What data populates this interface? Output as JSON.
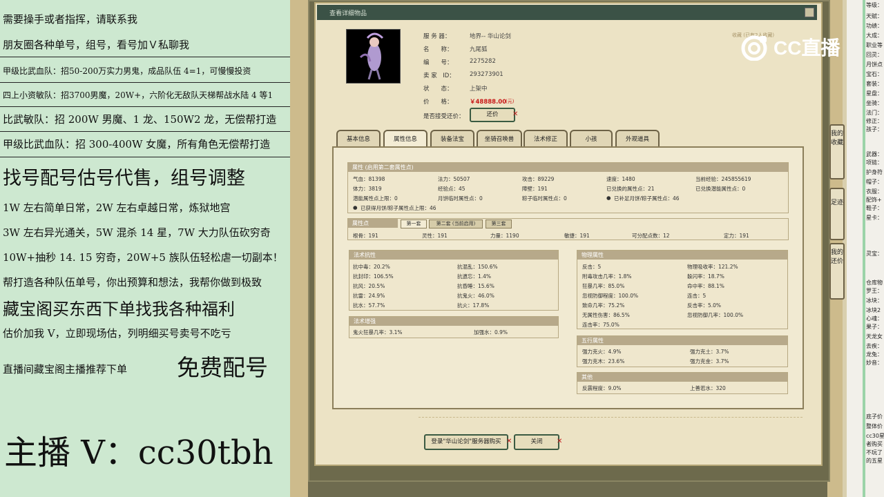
{
  "promo": {
    "lines": [
      "需要操手或者指挥，请联系我",
      "朋友圈各种单号，组号，看号加Ｖ私聊我",
      "甲级比武血队：招50-200万实力男鬼，成品队伍 4=1，可慢慢投资",
      "四上小资敏队：招3700男魔，20W+，六阶化无敌队天梯帮战水陆 4 等1",
      "比武敏队：招 200W 男魔、1 龙、150W2 龙，无偿帮打造",
      "甲级比武血队：招 300-400W 女魔，所有角色无偿帮打造",
      "找号配号估号代售，组号调整",
      "1W 左右简单日常，2W 左右卓越日常，炼狱地宫",
      "3W 左右异光通关，5W 混杀 14 星，7W 大力队伍砍穷奇",
      "10W+抽秒 14. 15 穷奇，20W+5 族队伍轻松虐一切副本！",
      "帮打造各种队伍单号，你出预算和想法，我帮你做到极致",
      "藏宝阁买东西下单找我各种福利",
      "估价加我 V，立即现场估，列明细买号卖号不吃亏",
      "直播间藏宝阁主播推荐下单",
      "免费配号",
      "主播 V：cc30tbh"
    ]
  },
  "window": {
    "title": "查看详细物品"
  },
  "brand": {
    "logo_text": "CC直播",
    "watermark": "收藏 (已有2人收藏)"
  },
  "item": {
    "labels": [
      "服 务 器：",
      "名　　称：",
      "编　　号：",
      "卖 家　ID：",
      "状　　态：",
      "价　　格：",
      "是否接受还价："
    ],
    "server": "地界-- 华山论剑",
    "name": "九尾狐",
    "number": "2275282",
    "seller_id": "293273901",
    "status": "上架中",
    "price": "￥48888.00",
    "price_unit": "(元)",
    "counter_btn": "还价"
  },
  "tabs": [
    "基本信息",
    "属性信息",
    "装备法宝",
    "坐骑召唤兽",
    "法术修正",
    "小孩",
    "外观道具"
  ],
  "attr": {
    "head": "属性 (启用第二套属性点)",
    "rows": [
      [
        "气血：81398",
        "法力：50507",
        "攻击：89229",
        "速度：1480",
        "当前经验：245855619"
      ],
      [
        "体力：3819",
        "经验点：45",
        "障壁：191",
        "已兑换的属性点：21",
        "已兑换潜能属性点：0"
      ],
      [
        "潜能属性点上限：0",
        "月饼临时属性点：0",
        "粽子临时属性点：0",
        "已补足月饼/粽子属性点：46",
        ""
      ]
    ],
    "note": "已获得月饼/粽子属性点上限：46"
  },
  "points": {
    "head": "属性点",
    "subtabs": [
      "第一套",
      "第二套 (当前启用)",
      "第三套"
    ],
    "row": [
      "根骨：191",
      "灵性：191",
      "力量：1190",
      "敏捷：191",
      "可分配点数：12",
      "定力：191"
    ]
  },
  "resist": {
    "head": "法术抗性",
    "rows": [
      [
        "抗中毒：20.2%",
        "抗混乱：150.6%"
      ],
      [
        "抗封印：106.5%",
        "抗遗忘：1.4%"
      ],
      [
        "抗风：20.5%",
        "抗昏睡：15.6%"
      ],
      [
        "抗雷：24.9%",
        "抗鬼火：46.0%"
      ],
      [
        "抗水：57.7%",
        "抗火：17.8%"
      ]
    ]
  },
  "enhance": {
    "head": "法术增强",
    "row": [
      "鬼火狂暴几率：3.1%",
      "加强水：0.9%"
    ]
  },
  "physical": {
    "head": "物理属性",
    "rows": [
      [
        "反击：5",
        "物理吸收率：121.2%"
      ],
      [
        "附毒攻击几率：1.8%",
        "躲闪率：18.7%"
      ],
      [
        "狂暴几率：85.0%",
        "命中率：88.1%"
      ],
      [
        "忽视防御程度：100.0%",
        "连击：5"
      ],
      [
        "致命几率：75.2%",
        "反击率：5.0%"
      ],
      [
        "无属性伤害：86.5%",
        "忽视防御几率：100.0%"
      ],
      [
        "连击率：75.0%",
        ""
      ]
    ]
  },
  "five": {
    "head": "五行属性",
    "rows": [
      [
        "强力克火：4.9%",
        "强力克土：3.7%"
      ],
      [
        "强力克木：23.6%",
        "强力克金：3.7%"
      ]
    ]
  },
  "other": {
    "head": "其他",
    "row": [
      "反震程度：9.0%",
      "上善若水：320"
    ]
  },
  "footer": {
    "buy_btn": "登录\"华山论剑\"服务器购买",
    "close_btn": "关闭"
  },
  "side_buttons": [
    "我的收藏",
    "足迹",
    "我的还价"
  ],
  "chat": [
    "等级：",
    "天赋：",
    "功绩：",
    "大成：",
    "职业等",
    "回灵：",
    "月饼点",
    "宝石：",
    "套装：",
    "星盘：",
    "坐骑：",
    "法门：",
    "修正：",
    "孩子：",
    "武器：",
    "项链：",
    "护身符",
    "帽子：",
    "衣服：",
    "配饰+",
    "鞋子：",
    "星卡：",
    "灵宝：",
    "仓库物",
    "罗王：",
    "冰块：",
    "冰块2",
    "心魂：",
    "果子：",
    "天龙女",
    "去疾：",
    "龙兔：",
    "妙音：",
    "底子价",
    "整体价",
    "cc30星",
    "者购买",
    "不玩了",
    "的五星"
  ]
}
